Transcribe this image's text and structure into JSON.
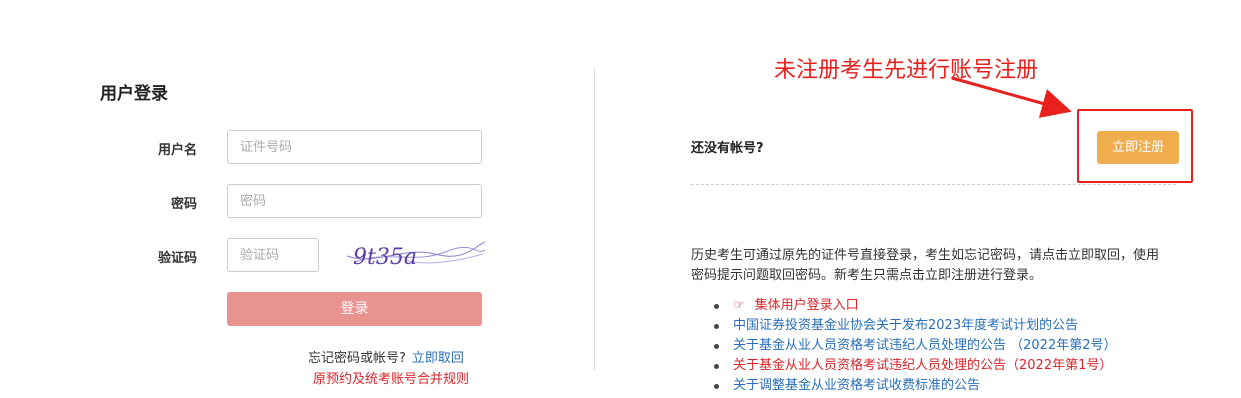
{
  "login": {
    "title": "用户登录",
    "username_label": "用户名",
    "username_placeholder": "证件号码",
    "password_label": "密码",
    "password_placeholder": "密码",
    "captcha_label": "验证码",
    "captcha_placeholder": "验证码",
    "captcha_text": "9t35a",
    "submit_label": "登录",
    "forgot_text": "忘记密码或帐号?",
    "forgot_link": "立即取回",
    "merge_rule_link": "原预约及统考账号合并规则"
  },
  "annotation": {
    "text": "未注册考生先进行账号注册",
    "color": "#e8201e"
  },
  "register": {
    "no_account_text": "还没有帐号?",
    "register_button": "立即注册",
    "button_color": "#f0ad4e"
  },
  "info": {
    "text": "历史考生可通过原先的证件号直接登录，考生如忘记密码，请点击立即取回，使用密码提示问题取回密码。新考生只需点击立即注册进行登录。"
  },
  "notices": [
    {
      "text": "集体用户登录入口",
      "color": "red",
      "icon": "hand-pointer-icon"
    },
    {
      "text": "中国证券投资基金业协会关于发布2023年度考试计划的公告",
      "color": "blue"
    },
    {
      "text": "关于基金从业人员资格考试违纪人员处理的公告 （2022年第2号）",
      "color": "blue"
    },
    {
      "text": "关于基金从业人员资格考试违纪人员处理的公告（2022年第1号）",
      "color": "red"
    },
    {
      "text": "关于调整基金从业资格考试收费标准的公告",
      "color": "blue"
    }
  ]
}
